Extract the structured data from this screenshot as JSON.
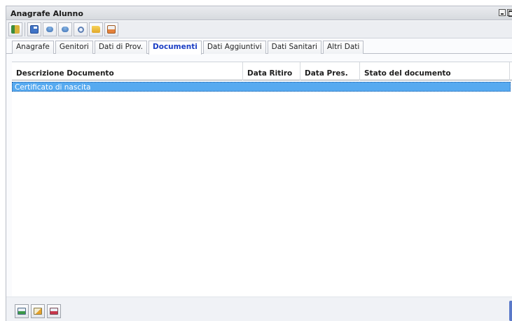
{
  "window": {
    "title": "Anagrafe Alunno"
  },
  "toolbar": {
    "buttons": [
      {
        "icon": "save-document-icon"
      },
      {
        "icon": "floppy-save-icon"
      },
      {
        "icon": "database-icon"
      },
      {
        "icon": "database-edit-icon"
      },
      {
        "icon": "search-icon"
      },
      {
        "icon": "folder-open-icon"
      },
      {
        "icon": "print-icon"
      }
    ]
  },
  "tabs": [
    {
      "label": "Anagrafe",
      "active": false
    },
    {
      "label": "Genitori",
      "active": false
    },
    {
      "label": "Dati di Prov.",
      "active": false
    },
    {
      "label": "Documenti",
      "active": true
    },
    {
      "label": "Dati Aggiuntivi",
      "active": false
    },
    {
      "label": "Dati Sanitari",
      "active": false
    },
    {
      "label": "Altri Dati",
      "active": false
    }
  ],
  "grid": {
    "columns": [
      "Descrizione Documento",
      "Data Ritiro",
      "Data Pres.",
      "Stato del documento"
    ],
    "rows": [
      {
        "description": "Certificato di nascita",
        "data_ritiro": "",
        "data_pres": "",
        "stato": "",
        "selected": true
      }
    ]
  },
  "bottom_toolbar": {
    "buttons": [
      {
        "icon": "add-row-icon"
      },
      {
        "icon": "edit-row-icon"
      },
      {
        "icon": "delete-row-icon"
      }
    ]
  },
  "colors": {
    "selection": "#57aaf0",
    "active_tab_text": "#1b3ec4"
  }
}
